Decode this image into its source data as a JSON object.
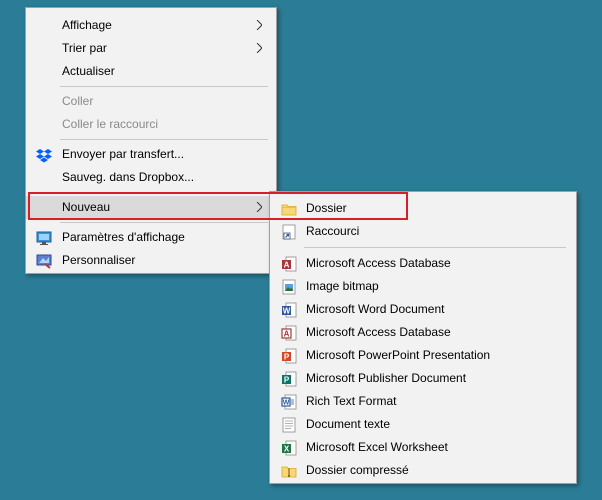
{
  "context_menu": {
    "items": [
      {
        "label": "Affichage",
        "has_submenu": true,
        "disabled": false
      },
      {
        "label": "Trier par",
        "has_submenu": true,
        "disabled": false
      },
      {
        "label": "Actualiser",
        "has_submenu": false,
        "disabled": false
      },
      {
        "label": "Coller",
        "disabled": true
      },
      {
        "label": "Coller le raccourci",
        "disabled": true
      },
      {
        "label": "Envoyer par transfert...",
        "icon": "dropbox-icon"
      },
      {
        "label": "Sauveg. dans Dropbox...",
        "icon": ""
      },
      {
        "label": "Nouveau",
        "has_submenu": true,
        "highlighted": true
      },
      {
        "label": "Paramètres d'affichage",
        "icon": "display-settings-icon"
      },
      {
        "label": "Personnaliser",
        "icon": "personalize-icon"
      }
    ]
  },
  "submenu": {
    "items": [
      {
        "label": "Dossier",
        "icon": "folder-icon"
      },
      {
        "label": "Raccourci",
        "icon": "shortcut-icon"
      },
      {
        "label": "Microsoft Access Database",
        "icon": "access-icon"
      },
      {
        "label": "Image bitmap",
        "icon": "bitmap-icon"
      },
      {
        "label": "Microsoft Word Document",
        "icon": "word-icon"
      },
      {
        "label": "Microsoft Access Database",
        "icon": "access-icon"
      },
      {
        "label": "Microsoft PowerPoint Presentation",
        "icon": "powerpoint-icon"
      },
      {
        "label": "Microsoft Publisher Document",
        "icon": "publisher-icon"
      },
      {
        "label": "Rich Text Format",
        "icon": "rtf-icon"
      },
      {
        "label": "Document texte",
        "icon": "text-document-icon"
      },
      {
        "label": "Microsoft Excel Worksheet",
        "icon": "excel-icon"
      },
      {
        "label": "Dossier compressé",
        "icon": "zip-folder-icon"
      }
    ]
  },
  "colors": {
    "desktop": "#2b7c96",
    "highlight_border": "#d61f2b",
    "dropbox_blue": "#0061fe",
    "access_red": "#a4373a",
    "word_blue": "#2b579a",
    "powerpoint_orange": "#d24726",
    "publisher_teal": "#077568",
    "excel_green": "#217346",
    "folder_yellow": "#f8d775"
  }
}
